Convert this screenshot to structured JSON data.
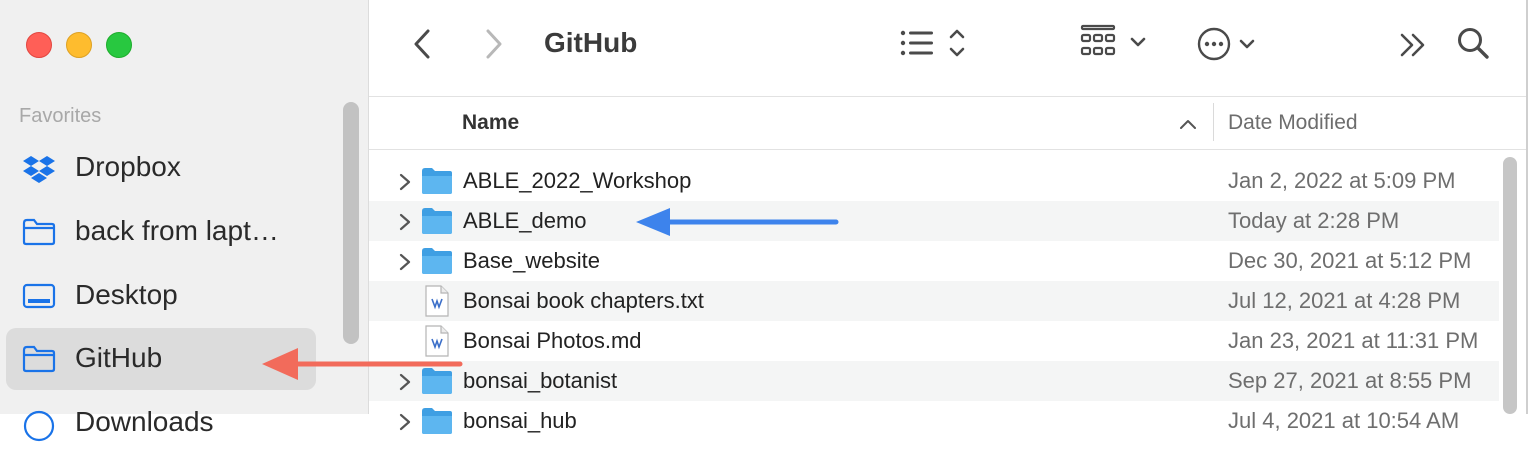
{
  "window": {
    "title": "GitHub"
  },
  "sidebar": {
    "section_title": "Favorites",
    "items": [
      {
        "label": "Dropbox",
        "icon": "dropbox-icon"
      },
      {
        "label": "back from lapt…",
        "icon": "folder-icon"
      },
      {
        "label": "Desktop",
        "icon": "desktop-icon"
      },
      {
        "label": "GitHub",
        "icon": "folder-icon",
        "selected": true
      },
      {
        "label": "Downloads",
        "icon": "download-icon"
      }
    ]
  },
  "columns": {
    "name": "Name",
    "date_modified": "Date Modified",
    "sort": "ascending"
  },
  "files": [
    {
      "name": "ABLE_2022_Workshop",
      "date": "Jan 2, 2022 at 5:09 PM",
      "kind": "folder"
    },
    {
      "name": "ABLE_demo",
      "date": "Today at 2:28 PM",
      "kind": "folder"
    },
    {
      "name": "Base_website",
      "date": "Dec 30, 2021 at 5:12 PM",
      "kind": "folder"
    },
    {
      "name": "Bonsai book chapters.txt",
      "date": "Jul 12, 2021 at 4:28 PM",
      "kind": "text-file"
    },
    {
      "name": "Bonsai Photos.md",
      "date": "Jan 23, 2021 at 11:31 PM",
      "kind": "text-file"
    },
    {
      "name": "bonsai_botanist",
      "date": "Sep 27, 2021 at 8:55 PM",
      "kind": "folder"
    },
    {
      "name": "bonsai_hub",
      "date": "Jul 4, 2021 at 10:54 AM",
      "kind": "folder"
    }
  ],
  "colors": {
    "folder": "#4ea9e8",
    "accent_blue": "#1a73e8",
    "arrow_red": "#f26b5b",
    "arrow_blue": "#3d83ec"
  }
}
